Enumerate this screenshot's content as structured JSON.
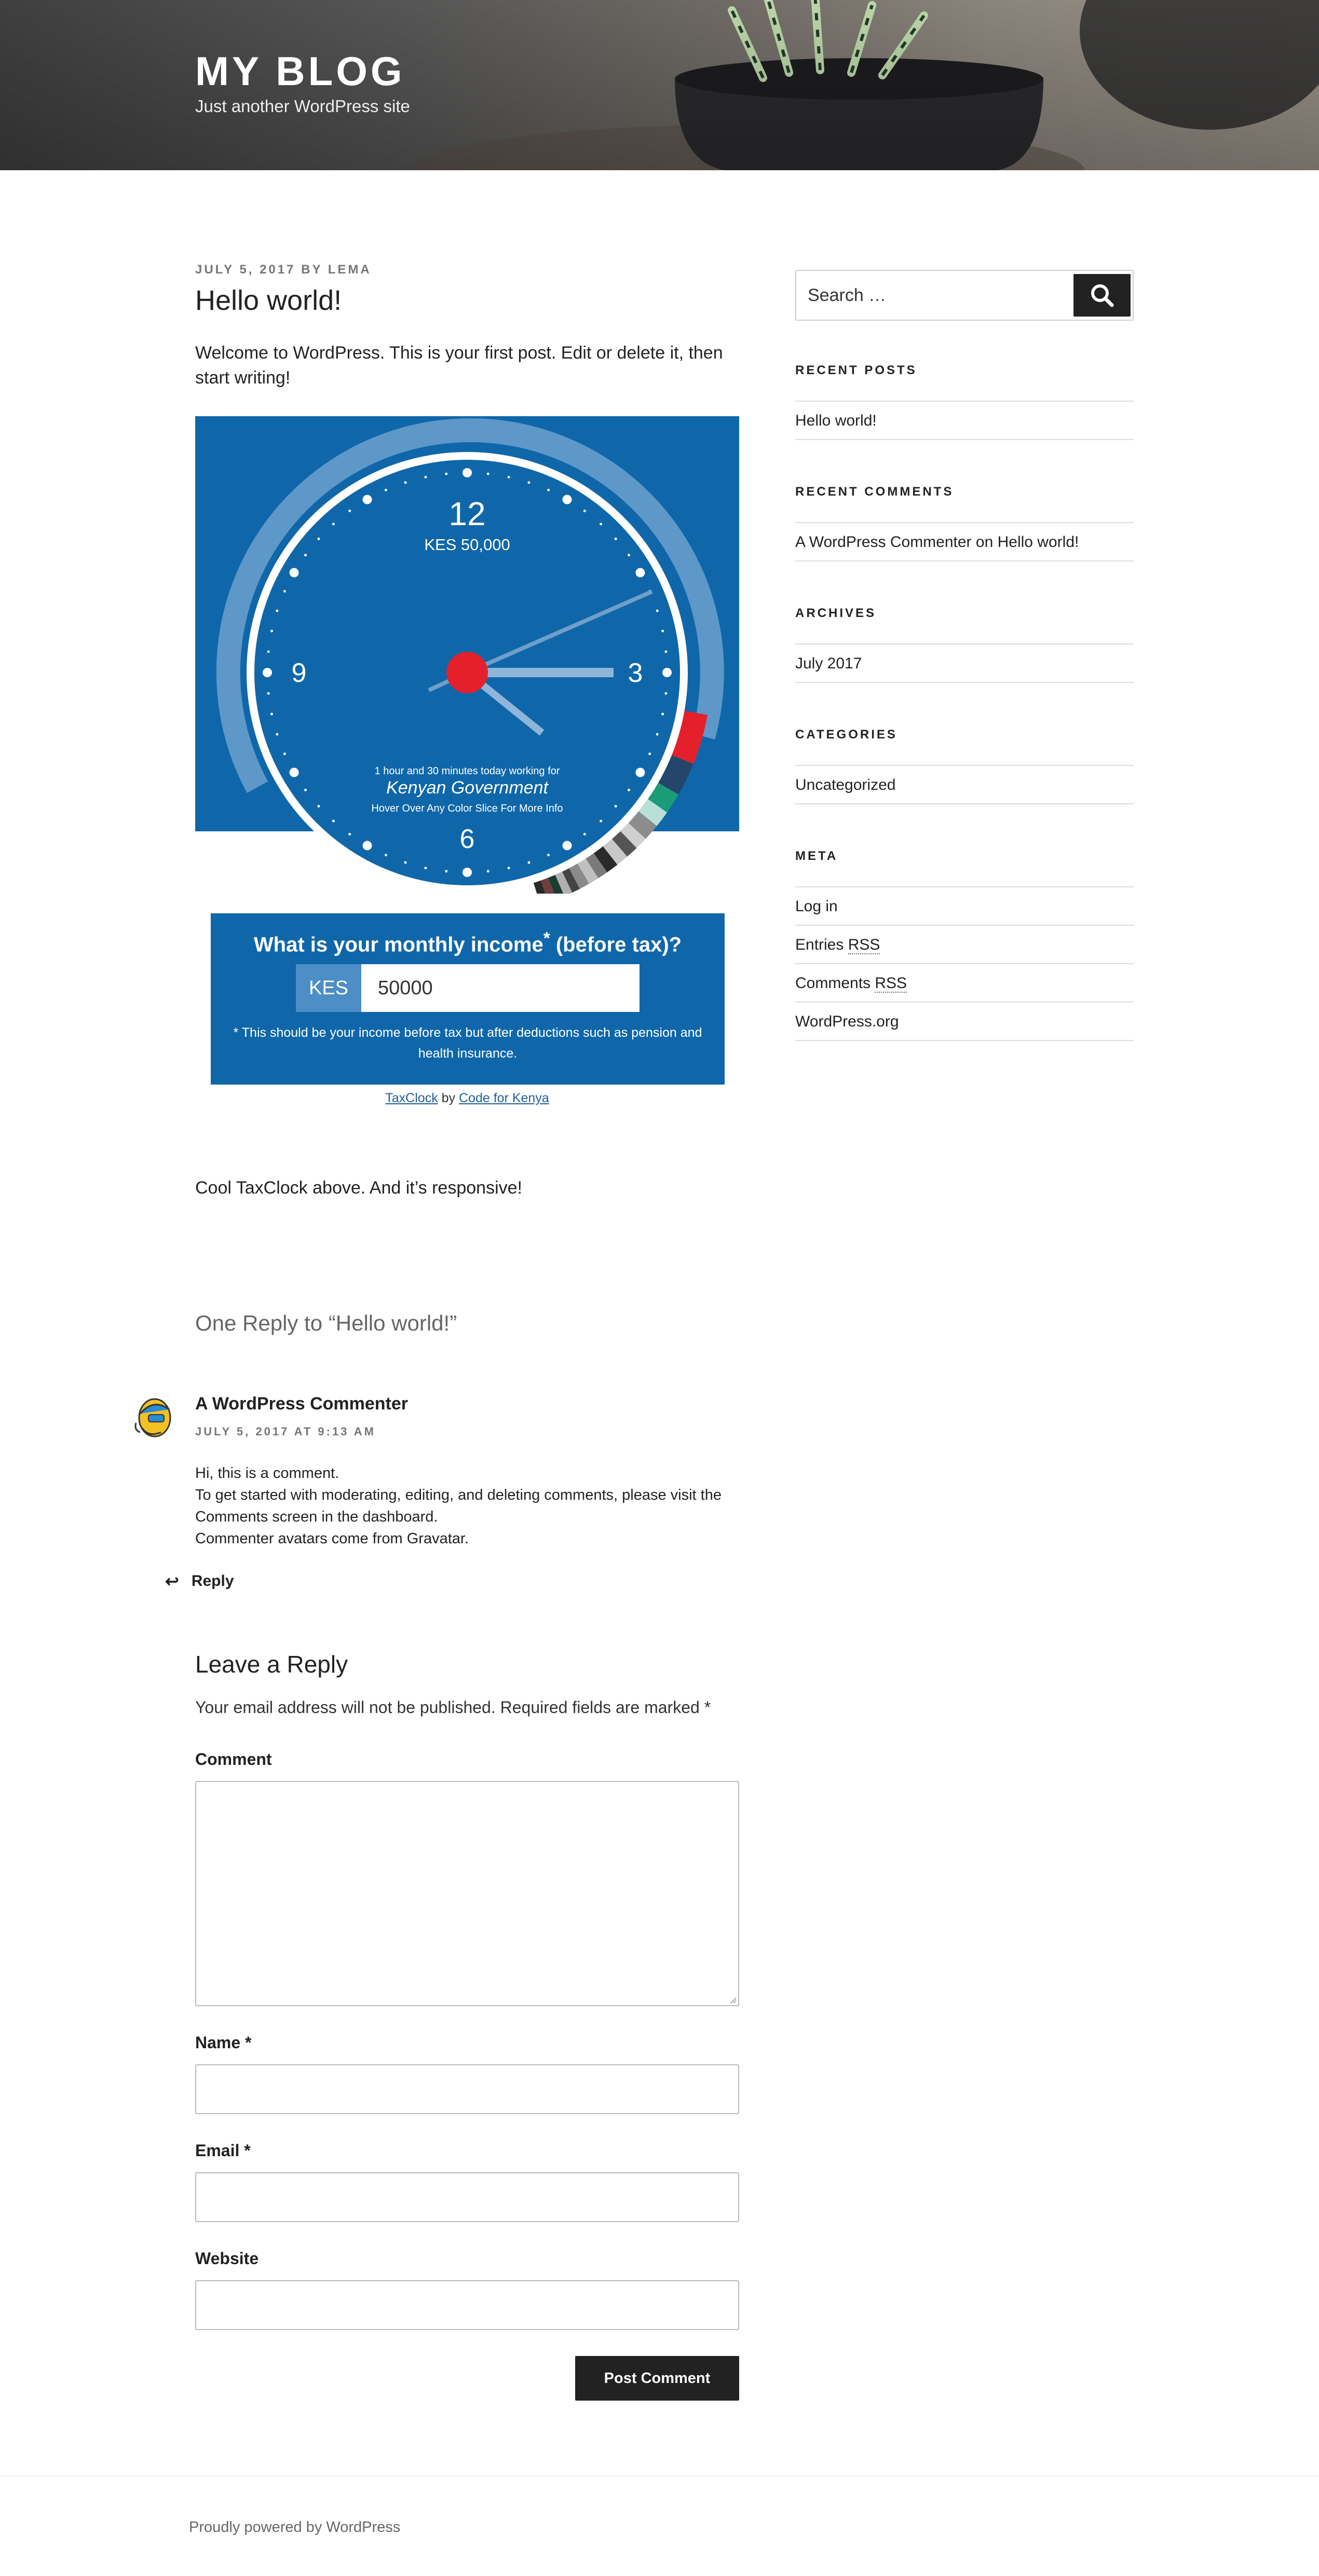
{
  "header": {
    "site_title": "MY BLOG",
    "tagline": "Just another WordPress site"
  },
  "post": {
    "date": "JULY 5, 2017",
    "by": "BY",
    "author": "LEMA",
    "title": "Hello world!",
    "intro": "Welcome to WordPress. This is your first post. Edit or delete it, then start writing!",
    "outro": "Cool TaxClock above. And it’s responsive!"
  },
  "taxclock": {
    "hour_12": "12",
    "hour_3": "3",
    "hour_6": "6",
    "hour_9": "9",
    "amount": "KES 50,000",
    "working_line": "1 hour and 30 minutes today working for",
    "entity": "Kenyan Government",
    "hover_hint": "Hover Over Any Color Slice For More Info",
    "income_question": "What is your monthly income",
    "income_question_star": "*",
    "income_question_tail": " (before tax)?",
    "currency": "KES",
    "income_value": "50000",
    "note": "* This should be your income before tax but after deductions such as pension and health insurance.",
    "credit_link1": "TaxClock",
    "credit_by": " by ",
    "credit_link2": "Code for Kenya",
    "colors": {
      "panel": "#0f67aa",
      "center": "#e3202b",
      "slices": [
        "#e3202b",
        "#25466b",
        "#1c9b78",
        "#b8e0d6",
        "#8c8c8c",
        "#d0d0d0",
        "#555555",
        "#c8c8c8",
        "#2a2a2a",
        "#7a7a7a",
        "#c0c0c0",
        "#8a8a8a",
        "#444444",
        "#b0b0b0",
        "#1a3d2f",
        "#6f3e3e",
        "#2a2a2a"
      ]
    }
  },
  "comments": {
    "title": "One Reply to “Hello world!”",
    "author": "A WordPress Commenter",
    "date": "JULY 5, 2017 AT 9:13 AM",
    "lines": [
      "Hi, this is a comment.",
      "To get started with moderating, editing, and deleting comments, please visit the Comments screen in the dashboard.",
      "Commenter avatars come from Gravatar."
    ],
    "reply": "Reply"
  },
  "reply_form": {
    "title": "Leave a Reply",
    "notes": "Your email address will not be published. Required fields are marked *",
    "comment_label": "Comment",
    "name_label": "Name *",
    "email_label": "Email *",
    "website_label": "Website",
    "submit": "Post Comment"
  },
  "sidebar": {
    "search_placeholder": "Search …",
    "recent_posts_title": "RECENT POSTS",
    "recent_posts": [
      "Hello world!"
    ],
    "recent_comments_title": "RECENT COMMENTS",
    "recent_comment_author": "A WordPress Commenter",
    "recent_comment_on": " on ",
    "recent_comment_post": "Hello world!",
    "archives_title": "ARCHIVES",
    "archives": [
      "July 2017"
    ],
    "categories_title": "CATEGORIES",
    "categories": [
      "Uncategorized"
    ],
    "meta_title": "META",
    "meta_login": "Log in",
    "meta_entries": "Entries ",
    "meta_comments": "Comments ",
    "meta_rss": "RSS",
    "meta_wporg": "WordPress.org"
  },
  "footer": {
    "text": "Proudly powered by WordPress"
  }
}
